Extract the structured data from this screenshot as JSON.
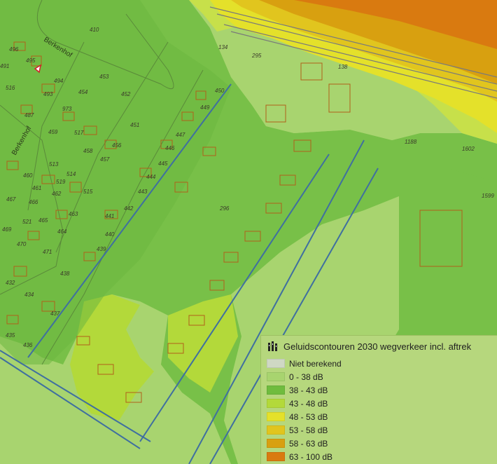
{
  "map": {
    "streets": [
      "Berkenhof",
      "Berkenhof"
    ],
    "road_number_label": "",
    "parcels": [
      "410",
      "496",
      "495",
      "491",
      "494",
      "516",
      "493",
      "453",
      "452",
      "454",
      "487",
      "973",
      "451",
      "459",
      "517",
      "456",
      "513",
      "458",
      "519",
      "457",
      "460",
      "514",
      "461",
      "515",
      "466",
      "462",
      "463",
      "441",
      "440",
      "439",
      "521",
      "465",
      "464",
      "467",
      "470",
      "471",
      "469",
      "438",
      "432",
      "434",
      "437",
      "435",
      "436",
      "450",
      "449",
      "447",
      "446",
      "445",
      "444",
      "443",
      "442",
      "296",
      "134",
      "295",
      "138",
      "1188",
      "1602",
      "1599"
    ],
    "colors": {
      "not_calculated": "#cfd8c4",
      "db_0_38": "#a8d46f",
      "db_38_43": "#6fbc3e",
      "db_43_48": "#b3d93a",
      "db_48_53": "#e4e12a",
      "db_53_58": "#e1c51e",
      "db_58_63": "#d8a010",
      "db_63_100": "#d97a10",
      "parcel_outline": "#b0601a",
      "waterway": "#3f6fa0"
    }
  },
  "legend": {
    "icon": "layers-icon",
    "title": "Geluidscontouren 2030 wegverkeer incl. aftrek",
    "items": [
      {
        "label": "Niet berekend",
        "color": "#cfd8c4"
      },
      {
        "label": "0 - 38 dB",
        "color": "#a8d46f"
      },
      {
        "label": "38 - 43 dB",
        "color": "#6fbc3e"
      },
      {
        "label": "43 - 48 dB",
        "color": "#b3d93a"
      },
      {
        "label": "48 - 53 dB",
        "color": "#e4e12a"
      },
      {
        "label": "53 - 58 dB",
        "color": "#e1c51e"
      },
      {
        "label": "58 - 63 dB",
        "color": "#d8a010"
      },
      {
        "label": "63 - 100 dB",
        "color": "#d97a10"
      }
    ]
  }
}
